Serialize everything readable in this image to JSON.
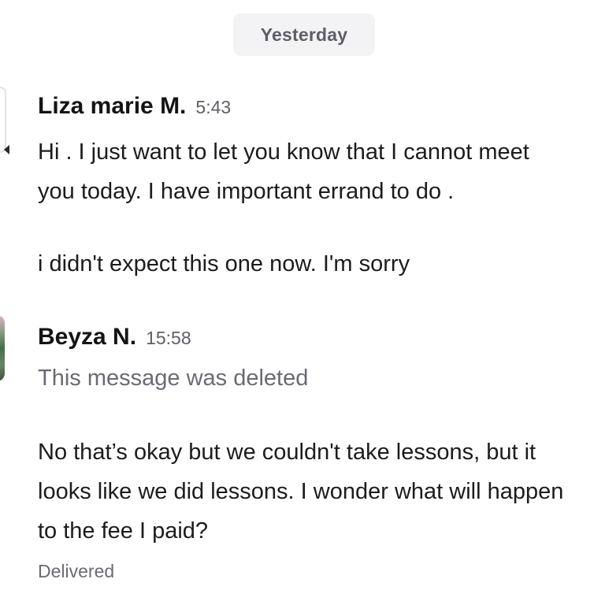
{
  "date_divider": {
    "label": "Yesterday"
  },
  "messages": [
    {
      "sender": "Liza marie M.",
      "time": "5:43",
      "lines": [
        "Hi . I just want to let you know that I cannot meet",
        "you today. I have important errand to do ."
      ],
      "followup": "i didn't expect this one now. I'm sorry",
      "avatar": "avatar-icon"
    },
    {
      "sender": "Beyza N.",
      "time": "15:58",
      "deleted_text": "This message was deleted",
      "lines": [
        "No that’s okay but we couldn't take lessons, but it",
        "looks like we did lessons. I wonder what will happen",
        "to the fee I paid?"
      ],
      "avatar": "avatar-photo"
    }
  ],
  "delivery_status": "Delivered"
}
